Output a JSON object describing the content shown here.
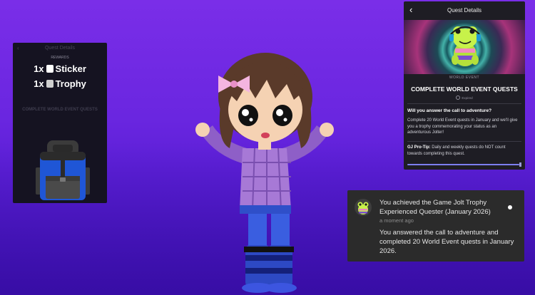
{
  "left_panel": {
    "title": "Quest Details",
    "back_icon": "‹",
    "rewards_label": "REWARDS",
    "rewards": [
      {
        "count": "1x",
        "icon": "sticker-icon",
        "label": "Sticker"
      },
      {
        "count": "1x",
        "icon": "trophy-icon",
        "label": "Trophy"
      }
    ],
    "quest_name": "COMPLETE WORLD EVENT QUESTS"
  },
  "quest_panel": {
    "back_icon": "‹",
    "title": "Quest Details",
    "quest_type": "WORLD EVENT",
    "quest_name": "COMPLETE WORLD EVENT QUESTS",
    "meta": "Expired",
    "question": "Will you answer the call to adventure?",
    "description": "Complete 20 World Event quests in January and we'll give you a trophy commemorating your status as an adventurous Jolter!",
    "tip_label": "GJ Pro-Tip:",
    "tip_text": " Daily and weekly quests do NOT count towards completing this quest.",
    "progress": 1.0
  },
  "notification": {
    "title": "You achieved the Game Jolt Trophy Experienced Quester (January 2026)",
    "time": "a moment ago",
    "body": "You answered the call to adventure and completed 20 World Event quests in January 2026."
  },
  "colors": {
    "background_top": "#7a2ee8",
    "background_bottom": "#3f12b8",
    "panel": "#1e1d24",
    "notification": "#2b2b2b",
    "frog_green": "#c7f24a",
    "progress": "#7d7ef0"
  }
}
